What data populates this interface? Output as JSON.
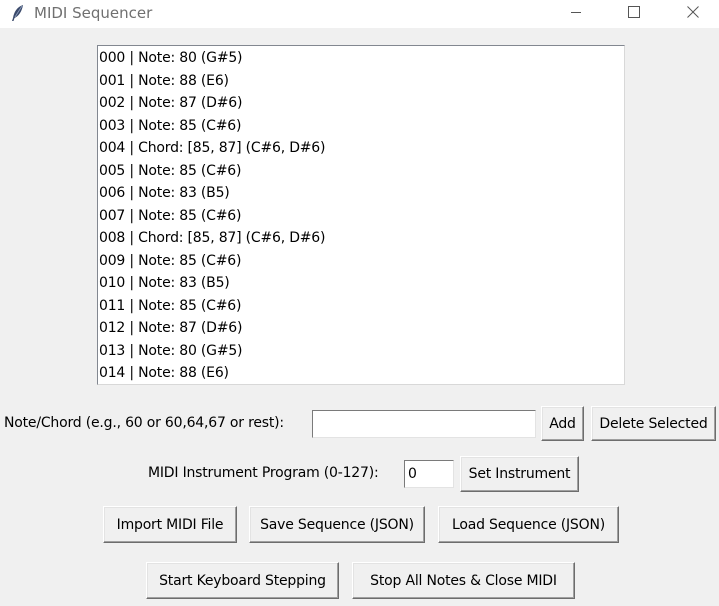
{
  "window": {
    "title": "MIDI Sequencer",
    "icon": "feather-icon",
    "controls": [
      "minimize-icon",
      "maximize-icon",
      "close-icon"
    ]
  },
  "sequence_list": {
    "items": [
      "000 | Note: 80 (G#5)",
      "001 | Note: 88 (E6)",
      "002 | Note: 87 (D#6)",
      "003 | Note: 85 (C#6)",
      "004 | Chord: [85, 87] (C#6, D#6)",
      "005 | Note: 85 (C#6)",
      "006 | Note: 83 (B5)",
      "007 | Note: 85 (C#6)",
      "008 | Chord: [85, 87] (C#6, D#6)",
      "009 | Note: 85 (C#6)",
      "010 | Note: 83 (B5)",
      "011 | Note: 85 (C#6)",
      "012 | Note: 87 (D#6)",
      "013 | Note: 80 (G#5)",
      "014 | Note: 88 (E6)"
    ]
  },
  "note_input": {
    "label": "Note/Chord (e.g., 60 or 60,64,67 or rest):",
    "value": "",
    "add_label": "Add",
    "delete_label": "Delete Selected"
  },
  "instrument": {
    "label": "MIDI Instrument Program (0-127):",
    "value": "0",
    "set_label": "Set Instrument"
  },
  "file_actions": {
    "import_label": "Import MIDI File",
    "save_label": "Save Sequence (JSON)",
    "load_label": "Load Sequence (JSON)"
  },
  "playback": {
    "start_label": "Start Keyboard Stepping",
    "stop_label": "Stop All Notes & Close MIDI"
  }
}
